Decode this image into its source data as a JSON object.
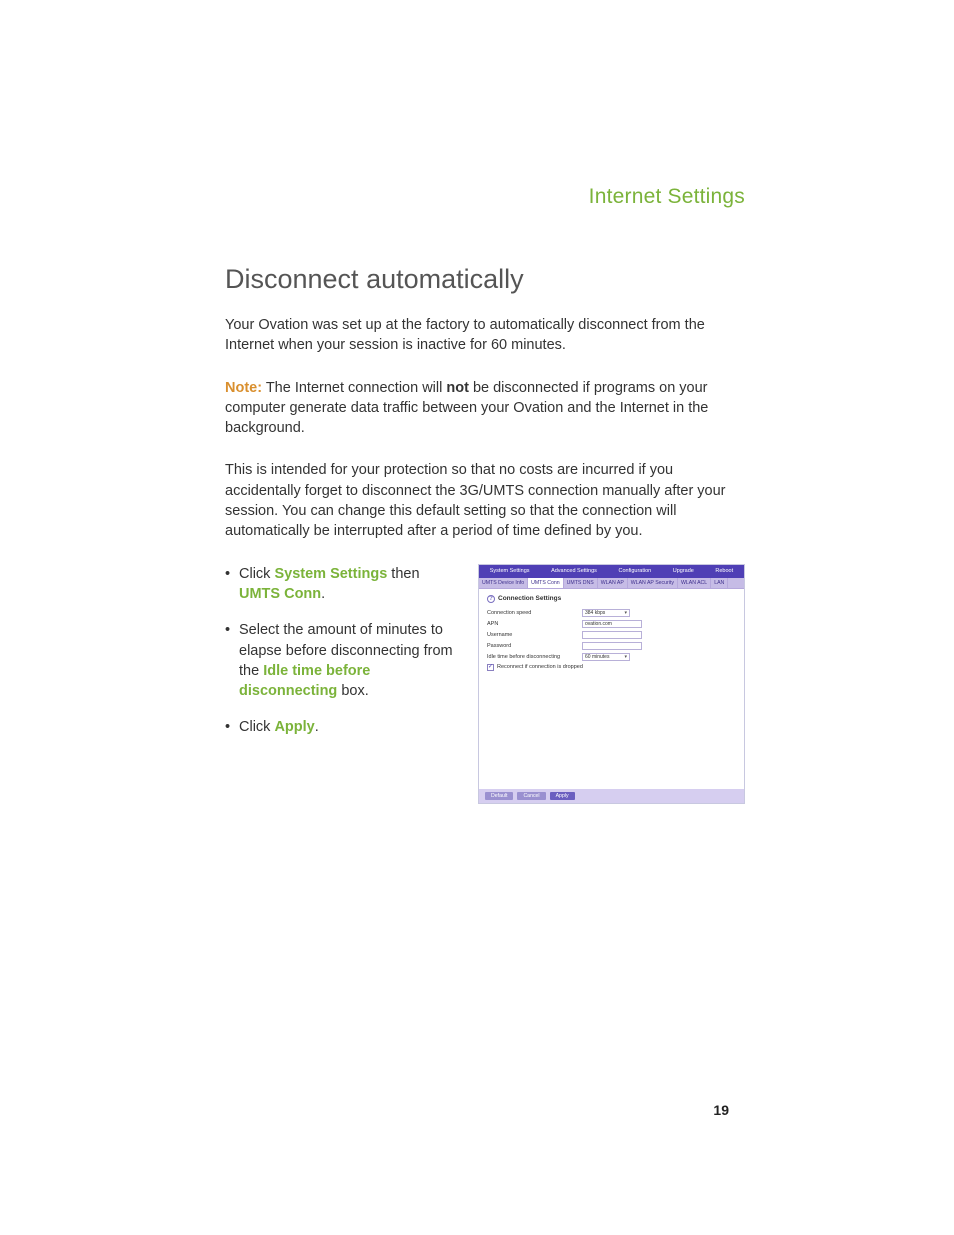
{
  "header": {
    "title": "Internet Settings"
  },
  "h1": "Disconnect automatically",
  "para1": "Your Ovation was set up at the factory to automatically disconnect from the Internet when your session is inactive for 60 minutes.",
  "note": {
    "label": "Note:",
    "before": " The Internet connection will ",
    "bold": "not",
    "after": " be disconnected if programs on your computer  generate data traffic between your Ovation and the Internet in the background."
  },
  "para2": "This is intended for your protection so that no costs are incurred if you accidentally forget to disconnect the 3G/UMTS connection manually after your session. You can change this default setting so that the connection will automatically be interrupted after a period of time defined by you.",
  "bullets": {
    "b1": {
      "pre": "Click ",
      "g1": "System Settings",
      "mid": " then ",
      "g2": "UMTS Conn",
      "post": "."
    },
    "b2": {
      "pre": "Select the amount of minutes to elapse before disconnecting from the ",
      "g1": "Idle time before disconnecting",
      "post": " box."
    },
    "b3": {
      "pre": "Click ",
      "g1": "Apply",
      "post": "."
    }
  },
  "shot": {
    "topnav": [
      "System Settings",
      "Advanced Settings",
      "Configuration",
      "Upgrade",
      "Reboot"
    ],
    "tabs": [
      "UMTS Device Info",
      "UMTS Conn",
      "UMTS DNS",
      "WLAN AP",
      "WLAN AP Security",
      "WLAN ACL",
      "LAN"
    ],
    "section": "Connection Settings",
    "rows": {
      "speed": {
        "label": "Connection speed",
        "value": "384 kbps"
      },
      "apn": {
        "label": "APN",
        "value": "ovation.com"
      },
      "user": {
        "label": "Username",
        "value": ""
      },
      "pass": {
        "label": "Password",
        "value": ""
      },
      "idle": {
        "label": "Idle time before disconnecting",
        "value": "60 minutes"
      }
    },
    "checkbox": "Reconnect if connection is dropped",
    "buttons": [
      "Default",
      "Cancel",
      "Apply"
    ]
  },
  "pagenum": "19"
}
